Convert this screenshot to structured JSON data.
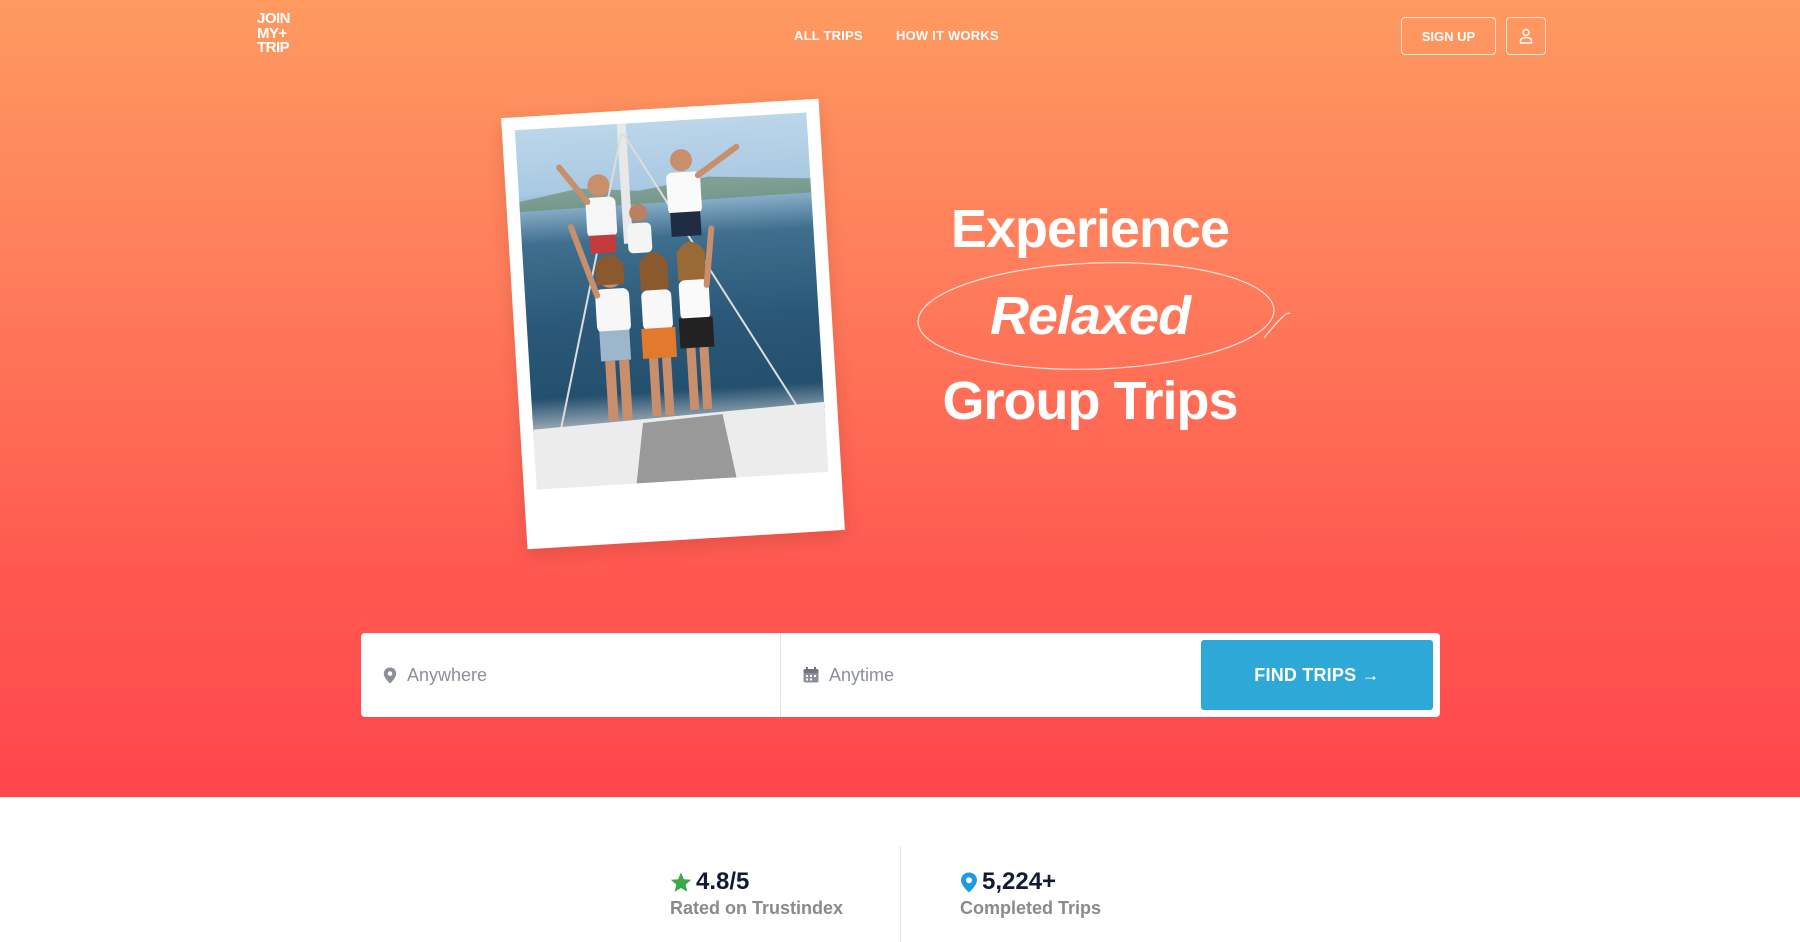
{
  "brand": {
    "logo_lines": [
      "JOIN",
      "MY+",
      "TRIP"
    ]
  },
  "nav": {
    "all_trips": "ALL TRIPS",
    "how_it_works": "HOW IT WORKS",
    "sign_up": "SIGN UP"
  },
  "hero": {
    "line1": "Experience",
    "line2": "Relaxed",
    "line3": "Group Trips"
  },
  "search": {
    "where_placeholder": "Anywhere",
    "when_placeholder": "Anytime",
    "find_label": "FIND TRIPS →"
  },
  "stats": [
    {
      "value": "4.8/5",
      "label": "Rated on Trustindex",
      "icon": "star-icon"
    },
    {
      "value": "5,224+",
      "label": "Completed Trips",
      "icon": "location-pin-icon"
    }
  ],
  "colors": {
    "hero_top": "#fe9a60",
    "hero_bottom": "#ff454d",
    "button_blue": "#2ea8d6",
    "star_green": "#3da84a",
    "pin_blue": "#1e9be0",
    "stat_text": "#141a33"
  }
}
